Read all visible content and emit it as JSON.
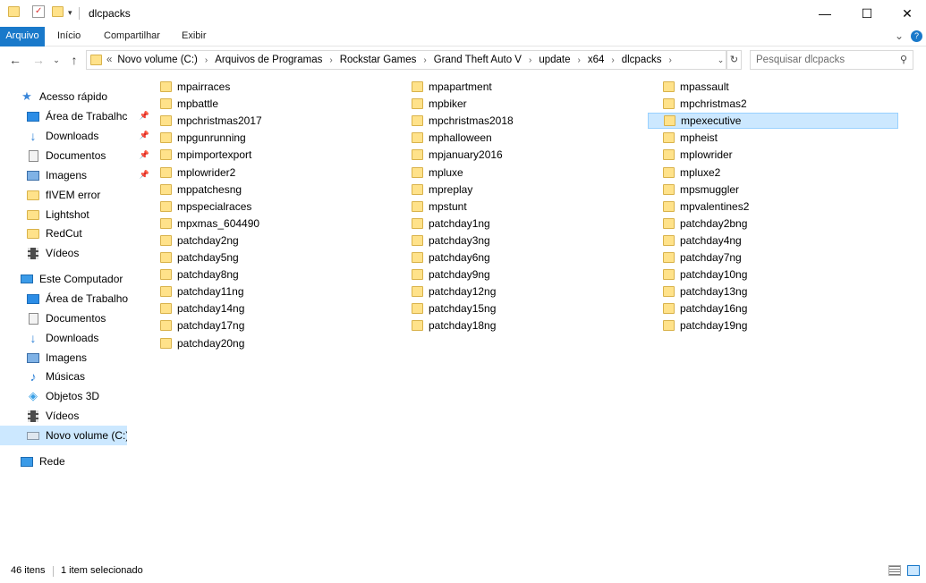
{
  "window": {
    "title": "dlcpacks",
    "minimize_glyph": "—",
    "maximize_glyph": "☐",
    "close_glyph": "✕"
  },
  "ribbon": {
    "tabs": [
      "Arquivo",
      "Início",
      "Compartilhar",
      "Exibir"
    ],
    "expand_glyph": "⌄",
    "help_glyph": "?"
  },
  "nav": {
    "back_glyph": "←",
    "forward_glyph": "→",
    "history_glyph": "⌄",
    "up_glyph": "↑"
  },
  "address": {
    "overflow": "«",
    "breadcrumbs": [
      "Novo volume (C:)",
      "Arquivos de Programas",
      "Rockstar Games",
      "Grand Theft Auto V",
      "update",
      "x64",
      "dlcpacks"
    ],
    "separator": "›",
    "dropdown_glyph": "⌄",
    "refresh_glyph": "↻"
  },
  "search": {
    "placeholder": "Pesquisar dlcpacks",
    "icon": "search-icon",
    "glyph": "⚲"
  },
  "sidebar": {
    "quick_access": {
      "label": "Acesso rápido",
      "items": [
        {
          "label": "Área de Trabalhc",
          "icon": "desktop-icon",
          "pinned": true
        },
        {
          "label": "Downloads",
          "icon": "download-icon",
          "pinned": true
        },
        {
          "label": "Documentos",
          "icon": "documents-icon",
          "pinned": true
        },
        {
          "label": "Imagens",
          "icon": "pictures-icon",
          "pinned": true
        },
        {
          "label": "fIVEM error",
          "icon": "folder-icon",
          "pinned": false
        },
        {
          "label": "Lightshot",
          "icon": "folder-icon",
          "pinned": false
        },
        {
          "label": "RedCut",
          "icon": "folder-icon",
          "pinned": false
        },
        {
          "label": "Vídeos",
          "icon": "videos-icon",
          "pinned": false
        }
      ]
    },
    "this_pc": {
      "label": "Este Computador",
      "items": [
        {
          "label": "Área de Trabalho",
          "icon": "desktop-icon"
        },
        {
          "label": "Documentos",
          "icon": "documents-icon"
        },
        {
          "label": "Downloads",
          "icon": "download-icon"
        },
        {
          "label": "Imagens",
          "icon": "pictures-icon"
        },
        {
          "label": "Músicas",
          "icon": "music-icon"
        },
        {
          "label": "Objetos 3D",
          "icon": "objects-3d-icon"
        },
        {
          "label": "Vídeos",
          "icon": "videos-icon"
        },
        {
          "label": "Novo volume (C:)",
          "icon": "drive-icon",
          "selected": true
        }
      ]
    },
    "network": {
      "label": "Rede",
      "icon": "network-icon"
    },
    "pin_glyph": "📌"
  },
  "files": {
    "columns": [
      [
        "mpairraces",
        "mpbattle",
        "mpchristmas2017",
        "mpgunrunning",
        "mpimportexport",
        "mplowrider2",
        "mppatchesng",
        "mpspecialraces",
        "mpxmas_604490",
        "patchday2ng",
        "patchday5ng",
        "patchday8ng",
        "patchday11ng",
        "patchday14ng",
        "patchday17ng",
        "patchday20ng"
      ],
      [
        "mpapartment",
        "mpbiker",
        "mpchristmas2018",
        "mphalloween",
        "mpjanuary2016",
        "mpluxe",
        "mpreplay",
        "mpstunt",
        "patchday1ng",
        "patchday3ng",
        "patchday6ng",
        "patchday9ng",
        "patchday12ng",
        "patchday15ng",
        "patchday18ng"
      ],
      [
        "mpassault",
        "mpchristmas2",
        "mpexecutive",
        "mpheist",
        "mplowrider",
        "mpluxe2",
        "mpsmuggler",
        "mpvalentines2",
        "patchday2bng",
        "patchday4ng",
        "patchday7ng",
        "patchday10ng",
        "patchday13ng",
        "patchday16ng",
        "patchday19ng"
      ]
    ],
    "selected": "mpexecutive"
  },
  "status": {
    "item_count": "46 itens",
    "selection": "1 item selecionado"
  }
}
